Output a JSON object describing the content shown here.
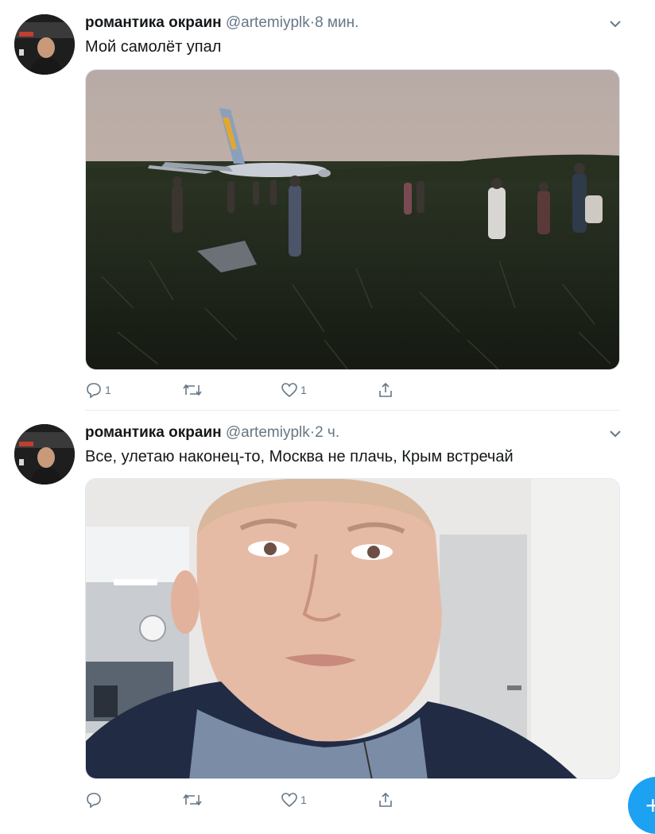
{
  "tweets": [
    {
      "name": "романтика окраин",
      "handle": "@artemiyplk",
      "separator": "·",
      "time": "8 мин.",
      "text": "Мой самолёт упал",
      "media_icon": "photo-plane-in-cornfield",
      "actions": {
        "reply_count": "1",
        "retweet_count": "",
        "like_count": "1",
        "share_icon": "share-icon"
      }
    },
    {
      "name": "романтика окраин",
      "handle": "@artemiyplk",
      "separator": "·",
      "time": "2 ч.",
      "text": "Все, улетаю наконец-то, Москва не плачь, Крым встречай",
      "media_icon": "photo-selfie-at-airport",
      "actions": {
        "reply_count": "",
        "retweet_count": "",
        "like_count": "1",
        "share_icon": "share-icon"
      }
    }
  ],
  "compose_button": {
    "label": "+"
  },
  "colors": {
    "accent": "#1da1f2",
    "muted": "#657786",
    "divider": "#e6ecf0"
  }
}
